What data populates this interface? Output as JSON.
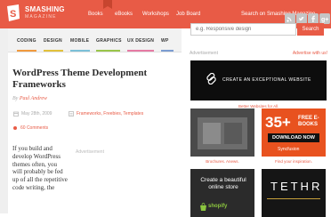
{
  "header": {
    "logo_title": "SMASHING",
    "logo_sub": "MAGAZINE",
    "nav": [
      "Books",
      "eBooks",
      "Workshops",
      "Job Board"
    ],
    "search_label": "Search on Smashing Magazine",
    "social_icons": [
      "rss-icon",
      "twitter-icon",
      "facebook-icon",
      "googleplus-icon"
    ],
    "colors": {
      "brand": "#e85b46"
    }
  },
  "categories": [
    {
      "label": "Coding",
      "color": "#f09a3e"
    },
    {
      "label": "Design",
      "color": "#e2c13b"
    },
    {
      "label": "Mobile",
      "color": "#7cc0d8"
    },
    {
      "label": "Graphics",
      "color": "#9ac54b"
    },
    {
      "label": "UX Design",
      "color": "#e57ba4"
    },
    {
      "label": "WP",
      "color": "#7c9dd1"
    }
  ],
  "search": {
    "placeholder": "e.g. Responsive design",
    "button": "Search"
  },
  "article": {
    "title": "WordPress Theme Development Frameworks",
    "by": "By",
    "author": "Paul Andrew",
    "date": "May 28th, 2009",
    "tags": "Frameworks, Freebies, Templates",
    "comments": "60 Comments",
    "body": "If you build and develop WordPress themes often, you will probably be fed up of all the repetitive code writing, the",
    "ad_label": "Advertisement"
  },
  "ads": {
    "label": "Advertisement",
    "with_us": "Advertise with us!",
    "big_text": "CREATE AN EXCEPTIONAL WEBSITE",
    "big_caption": "Better Websites for All.",
    "sq1_caption": "Brochures. Anews.",
    "sq2_big": "35+",
    "sq2_free": "FREE E-BOOKS",
    "sq2_dl": "DOWNLOAD NOW",
    "sq2_brand": "Syncfusion",
    "sq2_caption": "Find your inspiration.",
    "sq3_text": "Create a beautiful online store",
    "sq3_brand": "shopify",
    "sq4_text": "TETHR"
  }
}
